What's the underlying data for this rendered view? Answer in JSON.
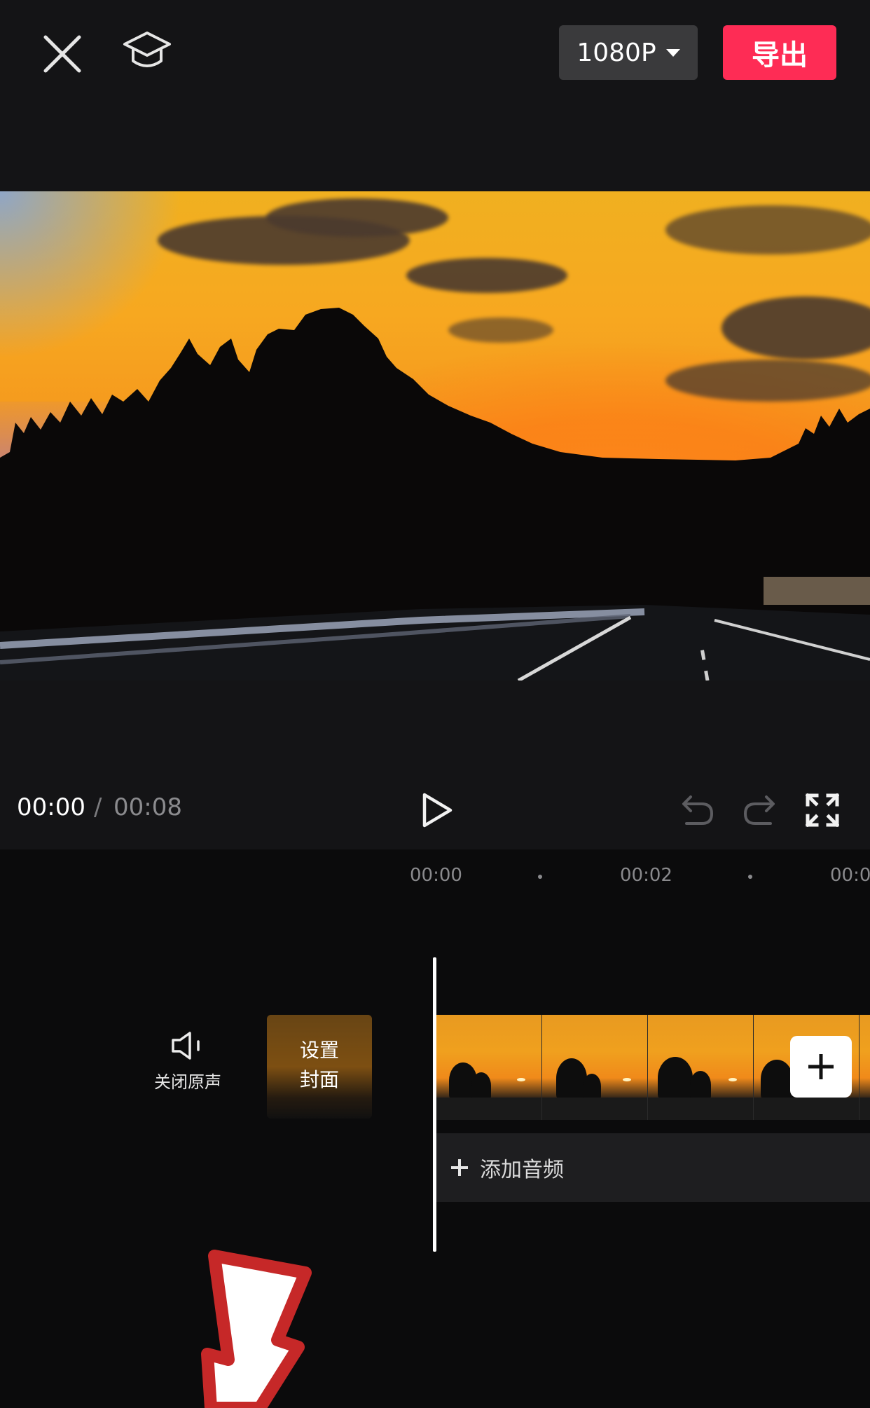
{
  "header": {
    "close_icon": "close-icon",
    "tutorial_icon": "graduation-cap-icon",
    "resolution_label": "1080P",
    "export_label": "导出",
    "colors": {
      "export_bg": "#fe2c55",
      "resolution_bg": "#3a3a3c"
    }
  },
  "preview": {
    "scene": "sunset-highway-video-frame"
  },
  "playback": {
    "current_time": "00:00",
    "separator": "/",
    "total_time": "00:08",
    "play_icon": "play-icon",
    "undo_icon": "undo-icon",
    "redo_icon": "redo-icon",
    "fullscreen_icon": "fullscreen-icon"
  },
  "timeline": {
    "ruler": [
      "00:00",
      "00:02",
      "00:0"
    ],
    "mute_label": "关闭原声",
    "mute_icon": "speaker-icon",
    "cover_label": "设置\n封面",
    "add_clip_icon": "plus-icon",
    "add_audio_label": "添加音频",
    "add_audio_icon": "plus-icon"
  },
  "annotation": {
    "arrow_color": "#c62828"
  }
}
